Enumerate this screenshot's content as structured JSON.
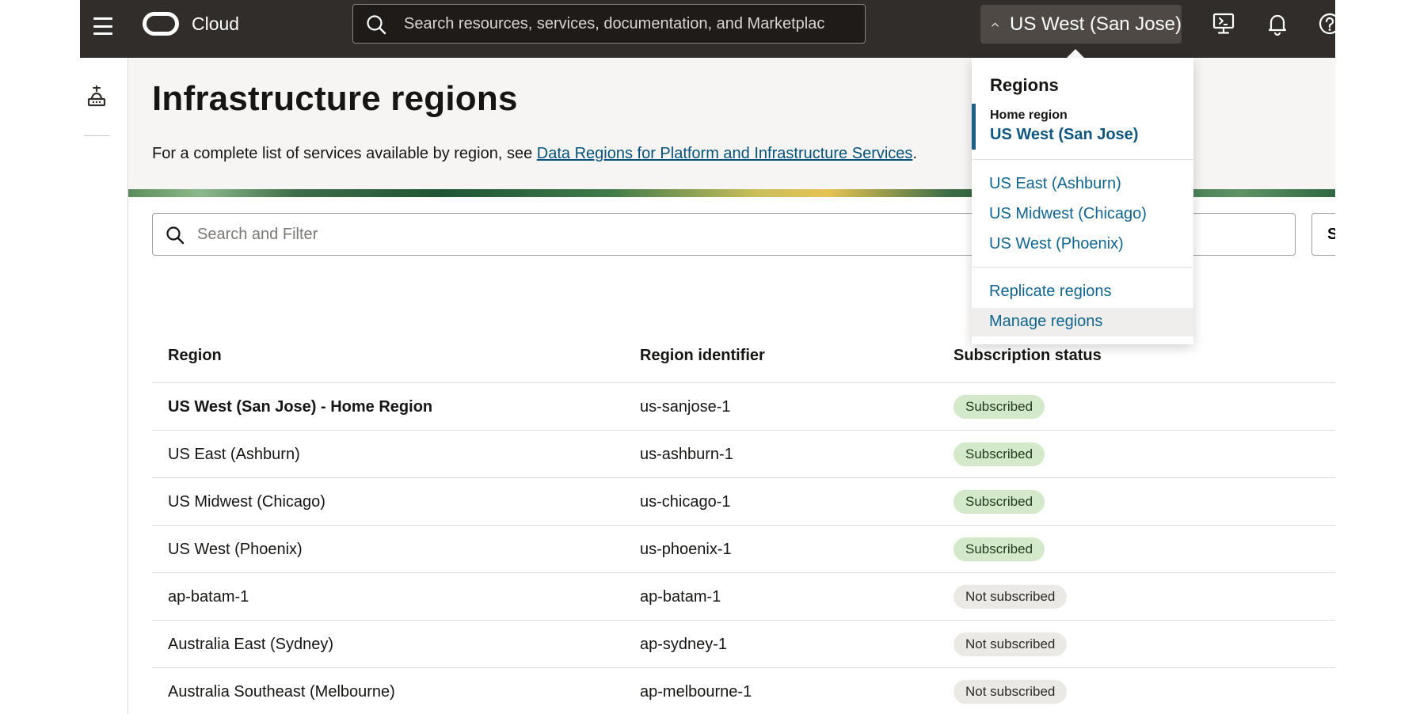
{
  "topbar": {
    "brand": "Cloud",
    "search_placeholder": "Search resources, services, documentation, and Marketplac",
    "region_button_label": "US West (San Jose)",
    "icons": [
      "menu-icon",
      "oracle-logo",
      "search-icon",
      "chevron-up-icon",
      "cloud-shell-icon",
      "bell-icon",
      "help-icon"
    ]
  },
  "page": {
    "title": "Infrastructure regions",
    "intro_text": "For a complete list of services available by region, see ",
    "intro_link": "Data Regions for Platform and Infrastructure Services",
    "intro_end": "."
  },
  "filter": {
    "placeholder": "Search and Filter",
    "side_button_label": "Se"
  },
  "table": {
    "headers": [
      "Region",
      "Region identifier",
      "Subscription status"
    ],
    "rows": [
      {
        "region": "US West (San Jose) - Home Region",
        "identifier": "us-sanjose-1",
        "status": "Subscribed"
      },
      {
        "region": "US East (Ashburn)",
        "identifier": "us-ashburn-1",
        "status": "Subscribed"
      },
      {
        "region": "US Midwest (Chicago)",
        "identifier": "us-chicago-1",
        "status": "Subscribed"
      },
      {
        "region": "US West (Phoenix)",
        "identifier": "us-phoenix-1",
        "status": "Subscribed"
      },
      {
        "region": "ap-batam-1",
        "identifier": "ap-batam-1",
        "status": "Not subscribed"
      },
      {
        "region": "Australia East (Sydney)",
        "identifier": "ap-sydney-1",
        "status": "Not subscribed"
      },
      {
        "region": "Australia Southeast (Melbourne)",
        "identifier": "ap-melbourne-1",
        "status": "Not subscribed"
      }
    ]
  },
  "dropdown": {
    "title": "Regions",
    "home_label": "Home region",
    "home_value": "US West (San Jose)",
    "regions": [
      "US East (Ashburn)",
      "US Midwest (Chicago)",
      "US West (Phoenix)"
    ],
    "actions": [
      "Replicate regions",
      "Manage regions"
    ]
  },
  "colors": {
    "topbar": "#312d2a",
    "link": "#04527a",
    "subscribed_badge": "#d4e9c9",
    "not_subscribed_badge": "#ebe9e6",
    "home_accent": "#1d5f86"
  }
}
